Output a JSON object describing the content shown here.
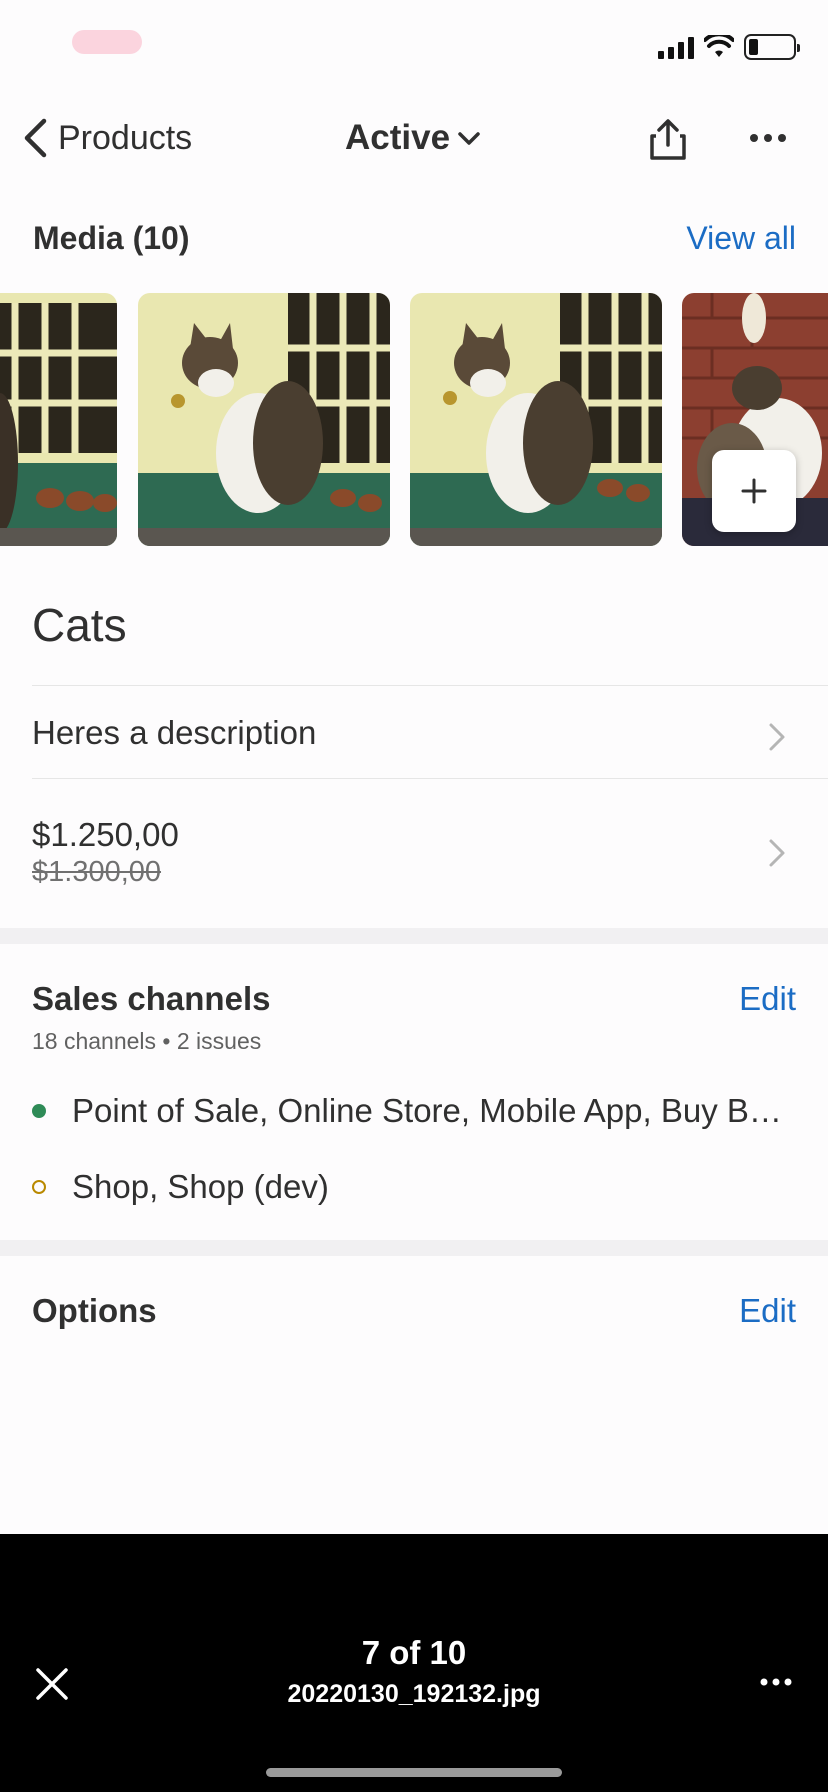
{
  "nav": {
    "back_label": "Products",
    "status_label": "Active"
  },
  "media": {
    "title": "Media (10)",
    "view_all": "View all"
  },
  "product": {
    "title": "Cats",
    "description": "Heres a description",
    "price": "$1.250,00",
    "compare_price": "$1.300,00"
  },
  "sales_channels": {
    "title": "Sales channels",
    "edit": "Edit",
    "summary": "18 channels • 2 issues",
    "items": [
      {
        "label": "Point of Sale, Online Store, Mobile App, Buy B…",
        "status_color": "#2e8b57"
      },
      {
        "label": "Shop, Shop (dev)",
        "status_color": "#b98900"
      }
    ]
  },
  "options": {
    "title": "Options",
    "edit": "Edit"
  },
  "viewer": {
    "counter": "7 of 10",
    "filename": "20220130_192132.jpg"
  },
  "colors": {
    "link": "#1b6cc4",
    "text": "#303030",
    "viewer_bg": "#000000"
  },
  "icons": [
    "signal-icon",
    "wifi-icon",
    "battery-icon",
    "chevron-left-icon",
    "chevron-down-icon",
    "share-icon",
    "more-icon",
    "plus-icon",
    "chevron-right-icon",
    "close-icon"
  ]
}
